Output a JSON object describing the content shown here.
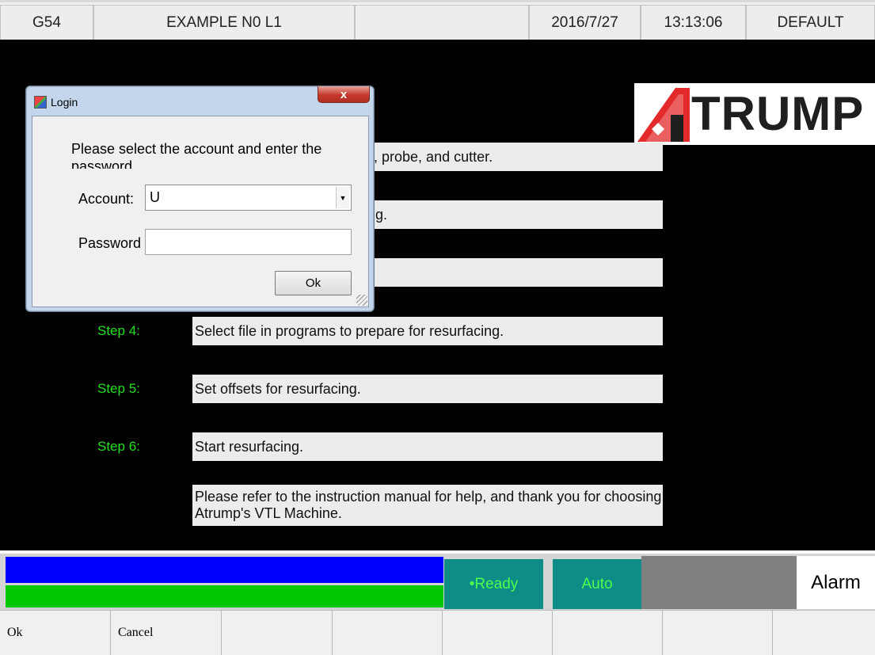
{
  "topbar": {
    "coord_system": "G54",
    "program": "EXAMPLE N0 L1",
    "date": "2016/7/27",
    "time": "13:13:06",
    "profile": "DEFAULT"
  },
  "logo": {
    "text": "TRUMP",
    "colors": {
      "red": "#e32a2a",
      "dark": "#1f1f1f"
    }
  },
  "steps": {
    "step1_text": "n, probe, and cutter.",
    "step2_text": "g.",
    "step3_text": "",
    "step4_label": "Step 4:",
    "step4_text": "Select file in programs to prepare for resurfacing.",
    "step5_label": "Step 5:",
    "step5_text": "Set offsets for resurfacing.",
    "step6_label": "Step 6:",
    "step6_text": "Start resurfacing.",
    "help_text": "Please refer to the instruction manual for help, and thank you for choosing Atrump's VTL Machine.",
    "label_color": "#21e021"
  },
  "status": {
    "ready": "•Ready",
    "auto": "Auto",
    "alarm": "Alarm",
    "colors": {
      "blue_bar": "#0000ff",
      "green_bar": "#00c800",
      "teal": "#0e8c86"
    }
  },
  "softkeys": {
    "ok": "Ok",
    "cancel": "Cancel"
  },
  "login_dialog": {
    "title": "Login",
    "close_glyph": "x",
    "message": "Please select the account and enter the password",
    "account_label": "Account:",
    "account_value": "U",
    "password_label": "Password:",
    "password_value": "",
    "ok_label": "Ok"
  }
}
